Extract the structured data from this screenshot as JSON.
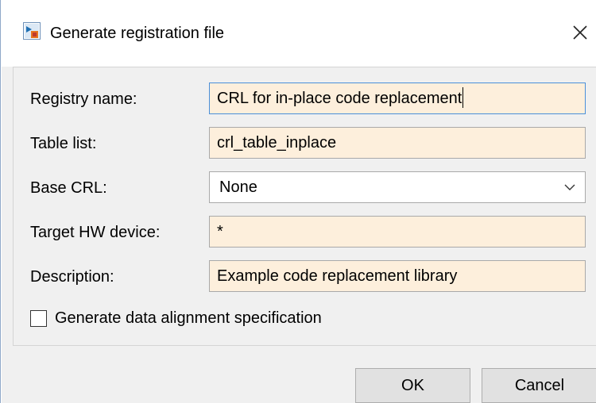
{
  "window": {
    "title": "Generate registration file",
    "app_icon": "simulink-app-icon",
    "close_icon": "close-icon"
  },
  "form": {
    "registry_name": {
      "label": "Registry name:",
      "value": "CRL for in-place code replacement"
    },
    "table_list": {
      "label": "Table list:",
      "value": "crl_table_inplace"
    },
    "base_crl": {
      "label": "Base CRL:",
      "selected": "None",
      "icon": "chevron-down-icon"
    },
    "target_hw_device": {
      "label": "Target HW device:",
      "value": "*"
    },
    "description": {
      "label": "Description:",
      "value": "Example code replacement library"
    },
    "data_alignment": {
      "label": "Generate data alignment specification",
      "checked": false
    }
  },
  "buttons": {
    "ok": "OK",
    "cancel": "Cancel"
  },
  "colors": {
    "input_background": "#fdefdc",
    "focus_border": "#4a8fd9",
    "dialog_background": "#f0f0f0"
  }
}
